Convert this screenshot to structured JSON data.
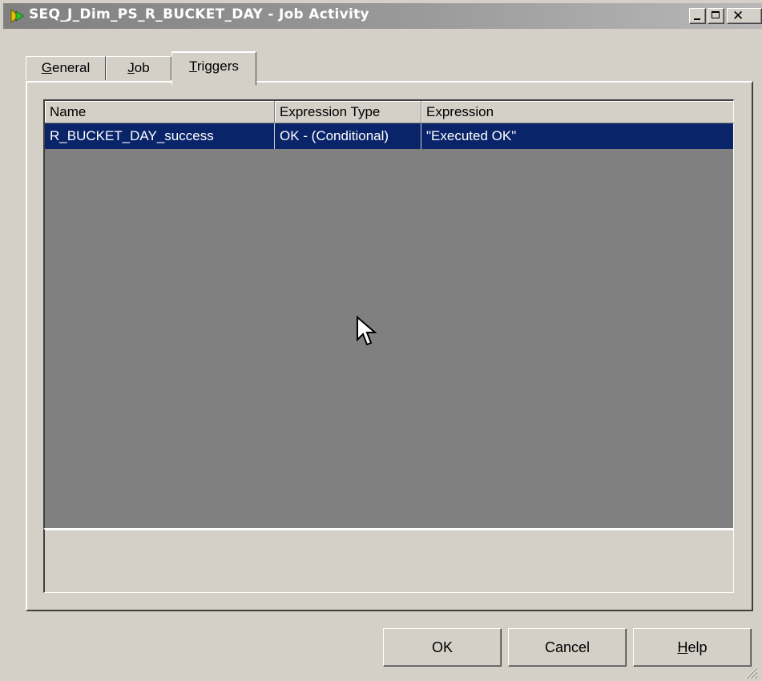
{
  "window": {
    "title": "SEQ_J_Dim_PS_R_BUCKET_DAY - Job Activity",
    "icon": "job-activity-icon",
    "controls": {
      "minimize": "minimize-icon",
      "maximize": "maximize-icon",
      "close": "✕"
    }
  },
  "tabs": [
    {
      "label": "General",
      "access_key": "G",
      "rest": "eneral",
      "selected": false
    },
    {
      "label": "Job",
      "access_key": "J",
      "rest": "ob",
      "selected": false
    },
    {
      "label": "Triggers",
      "access_key": "T",
      "rest": "riggers",
      "selected": true
    }
  ],
  "grid": {
    "columns": [
      "Name",
      "Expression Type",
      "Expression"
    ],
    "rows": [
      {
        "name": "R_BUCKET_DAY_success",
        "expression_type": "OK - (Conditional)",
        "expression": "\"Executed OK\"",
        "selected": true
      }
    ]
  },
  "buttons": {
    "ok": "OK",
    "cancel": "Cancel",
    "help_key": "H",
    "help_rest": "elp"
  },
  "colors": {
    "selection": "#0a246a",
    "grid_background": "#808080",
    "face": "#d4d0c8"
  }
}
